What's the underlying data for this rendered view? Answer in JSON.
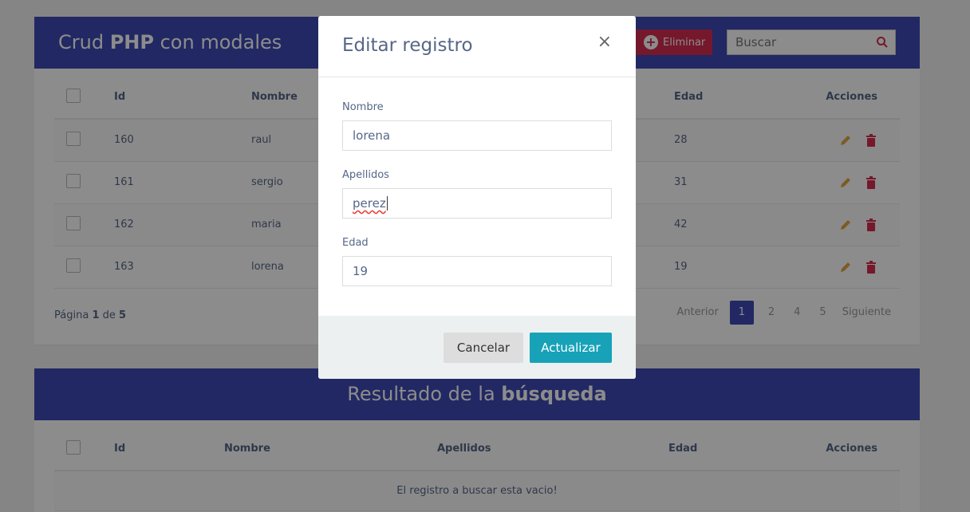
{
  "main": {
    "title_prefix": "Crud ",
    "title_bold": "PHP",
    "title_suffix": " con modales",
    "delete_label": "Eliminar",
    "search_placeholder": "Buscar",
    "columns": [
      "Id",
      "Nombre",
      "Edad",
      "Acciones"
    ],
    "rows": [
      {
        "id": "160",
        "nombre": "raul",
        "edad": "28"
      },
      {
        "id": "161",
        "nombre": "sergio",
        "edad": "31"
      },
      {
        "id": "162",
        "nombre": "maria",
        "edad": "42"
      },
      {
        "id": "163",
        "nombre": "lorena",
        "edad": "19"
      }
    ],
    "footer": {
      "prefix": "Página ",
      "current": "1",
      "middle": " de ",
      "total": "5"
    },
    "pagination": {
      "prev": "Anterior",
      "pages": [
        "1",
        "2",
        "4",
        "5"
      ],
      "next": "Siguiente"
    }
  },
  "search_results": {
    "title_prefix": "Resultado de la ",
    "title_bold": "búsqueda",
    "columns": [
      "Id",
      "Nombre",
      "Apellidos",
      "Edad",
      "Acciones"
    ],
    "empty_message": "El registro a buscar esta vacio!"
  },
  "modal": {
    "title": "Editar registro",
    "close_glyph": "×",
    "fields": [
      {
        "label": "Nombre",
        "value": "lorena"
      },
      {
        "label": "Apellidos",
        "value": "perez"
      },
      {
        "label": "Edad",
        "value": "19"
      }
    ],
    "cancel_label": "Cancelar",
    "update_label": "Actualizar"
  },
  "colors": {
    "header_bg": "#3e4ab5",
    "delete_button": "#d62d4f",
    "update_button": "#17a2b8",
    "edit_icon": "#e6a540",
    "trash_icon": "#d62d4f"
  },
  "icons": [
    "plus-circle-icon",
    "search-icon",
    "pencil-icon",
    "trash-icon",
    "close-icon"
  ]
}
